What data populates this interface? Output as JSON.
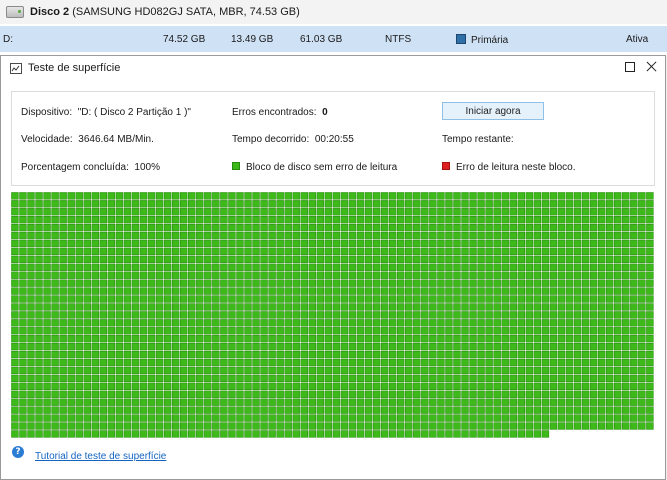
{
  "background": {
    "disk_header": {
      "name": "Disco 2",
      "detail": " (SAMSUNG HD082GJ SATA, MBR, 74.53 GB)"
    },
    "partition_row": {
      "drive": "D:",
      "capacity": "74.52 GB",
      "used": "13.49 GB",
      "unused": "61.03 GB",
      "filesystem": "NTFS",
      "type": "Primária",
      "status": "Ativa"
    }
  },
  "dialog": {
    "title": "Teste de superfície",
    "labels": {
      "device": "Dispositivo:",
      "speed": "Velocidade:",
      "percent": "Porcentagem concluída:",
      "errors": "Erros encontrados:",
      "elapsed": "Tempo decorrido:",
      "remaining": "Tempo restante:"
    },
    "values": {
      "device": "\"D: ( Disco 2 Partição 1 )\"",
      "speed": "3646.64 MB/Min.",
      "percent": "100%",
      "errors": "0",
      "elapsed": "00:20:55",
      "remaining": ""
    },
    "start_button": "Iniciar agora",
    "legend": {
      "ok": "Bloco de disco sem erro de leitura",
      "error": "Erro de leitura neste bloco."
    },
    "help_link": "Tutorial de teste de superfície",
    "block_grid": {
      "columns": 80,
      "rows": 31,
      "last_row_filled": 67
    }
  },
  "colors": {
    "block_ok": "#3dba1a",
    "block_error": "#e02020",
    "selected_row": "#cfe1f5",
    "button_bg": "#e5f1fb",
    "link": "#1565c0"
  }
}
